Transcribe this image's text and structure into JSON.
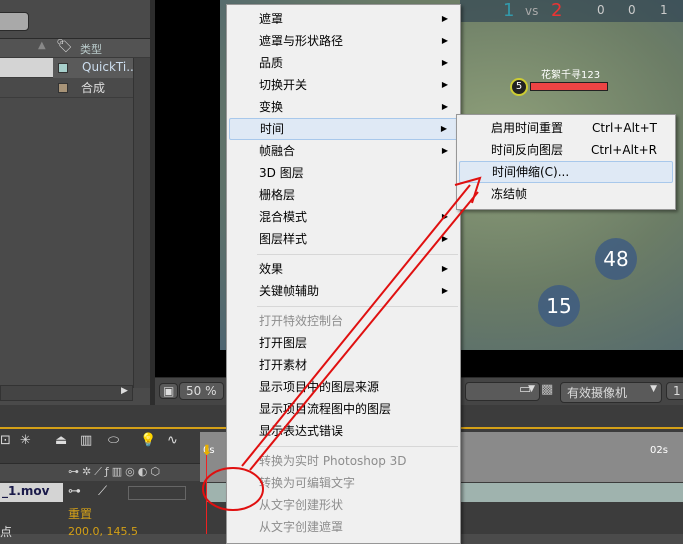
{
  "project_panel": {
    "column_type": "类型",
    "rows": [
      {
        "type": "QuickTi...",
        "color": "#a8d0cc"
      },
      {
        "type": "合成",
        "color": "#a89478"
      }
    ]
  },
  "viewer": {
    "zoom": "50 %",
    "camera": "有效摄像机",
    "partial": "1",
    "game_hud": {
      "blue_score": "1",
      "vs": "vs",
      "red_score": "2",
      "kills": "0",
      "deaths": "0",
      "assists": "1",
      "player_name": "花絮千寻123",
      "level": "5",
      "timer_a": "48",
      "timer_b": "15"
    }
  },
  "timeline": {
    "time_start": "0s",
    "time_02": "02s",
    "layer_name": "_1.mov",
    "prop_reset": "重置",
    "prop_value": "200.0, 145.5",
    "prop_label": "点"
  },
  "context_menu": {
    "items": [
      {
        "label": "遮罩",
        "submenu": true
      },
      {
        "label": "遮罩与形状路径",
        "submenu": true
      },
      {
        "label": "品质",
        "submenu": true
      },
      {
        "label": "切换开关",
        "submenu": true
      },
      {
        "label": "变换",
        "submenu": true
      },
      {
        "label": "时间",
        "submenu": true
      },
      {
        "label": "帧融合",
        "submenu": true
      },
      {
        "label": "3D 图层"
      },
      {
        "label": "栅格层"
      },
      {
        "label": "混合模式",
        "submenu": true
      },
      {
        "label": "图层样式",
        "submenu": true
      },
      {
        "label": "效果",
        "submenu": true
      },
      {
        "label": "关键帧辅助",
        "submenu": true
      },
      {
        "label": "打开特效控制台",
        "disabled": true
      },
      {
        "label": "打开图层"
      },
      {
        "label": "打开素材"
      },
      {
        "label": "显示项目中的图层来源"
      },
      {
        "label": "显示项目流程图中的图层"
      },
      {
        "label": "显示表达式错误"
      },
      {
        "label": "转换为实时 Photoshop 3D",
        "disabled": true
      },
      {
        "label": "转换为可编辑文字",
        "disabled": true
      },
      {
        "label": "从文字创建形状",
        "disabled": true
      },
      {
        "label": "从文字创建遮罩",
        "disabled": true
      }
    ]
  },
  "time_submenu": {
    "items": [
      {
        "label": "启用时间重置",
        "shortcut": "Ctrl+Alt+T"
      },
      {
        "label": "时间反向图层",
        "shortcut": "Ctrl+Alt+R"
      },
      {
        "label": "时间伸缩(C)..."
      },
      {
        "label": "冻结帧"
      }
    ]
  },
  "annotation_color": "#e01010"
}
